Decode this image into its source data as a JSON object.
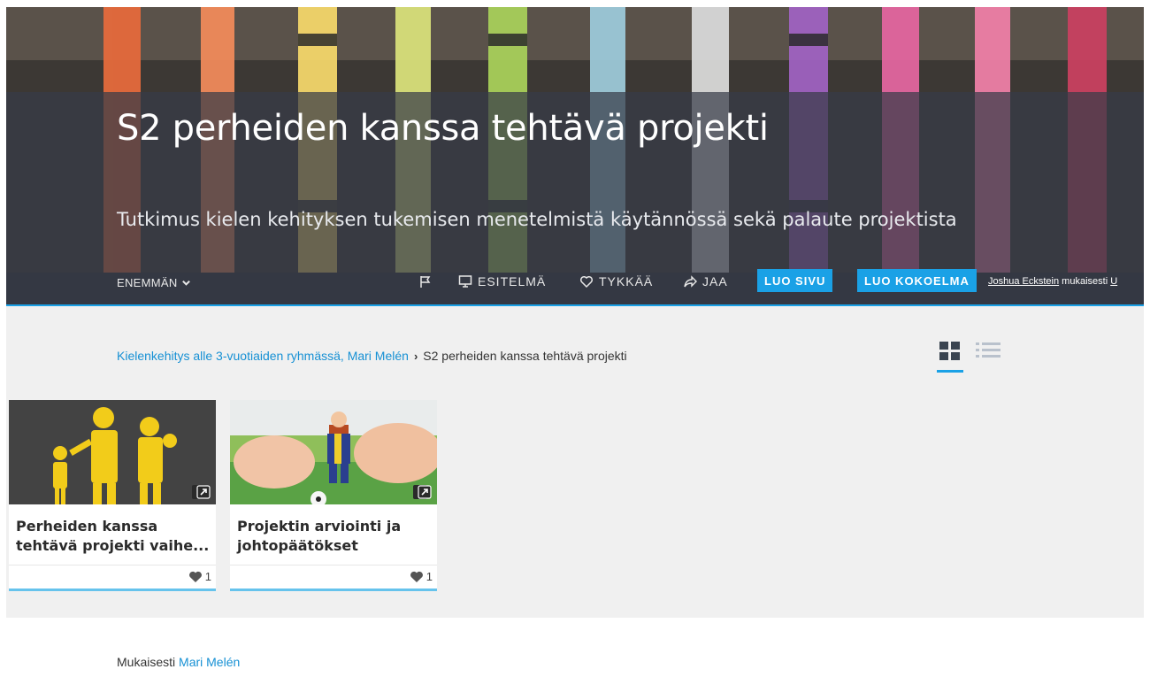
{
  "hero": {
    "title": "S2 perheiden kanssa tehtävä projekti",
    "subtitle": "Tutkimus kielen kehityksen tukemisen menetelmistä käytännössä sekä palaute projektista",
    "toolbar": {
      "more_label": "ENEMMÄN",
      "present_label": "ESITELMÄ",
      "like_label": "TYKKÄÄ",
      "share_label": "JAA",
      "create_page_label": "LUO SIVU",
      "create_collection_label": "LUO KOKOELMA"
    },
    "credit": {
      "author": "Joshua Eckstein",
      "suffix": "mukaisesti",
      "truncated": "U"
    }
  },
  "breadcrumb": {
    "parent": "Kielenkehitys alle 3-vuotiaiden ryhmässä, Mari Melén",
    "separator": "›",
    "current": "S2 perheiden kanssa tehtävä projekti"
  },
  "cards": [
    {
      "title": "Perheiden kanssa tehtävä projekti vaihe...",
      "likes": "1"
    },
    {
      "title": "Projektin arviointi ja johtopäätökset",
      "likes": "1"
    }
  ],
  "footer": {
    "prefix": "Mukaisesti",
    "author": "Mari Melén"
  },
  "colors": {
    "accent": "#1aa1e6",
    "link": "#1690d4",
    "content_bg": "#f0f0f0"
  },
  "icons": [
    "flag-icon",
    "monitor-icon",
    "heart-outline-icon",
    "share-icon",
    "chevron-down-icon",
    "grid-view-icon",
    "list-view-icon",
    "external-link-icon",
    "heart-icon"
  ]
}
